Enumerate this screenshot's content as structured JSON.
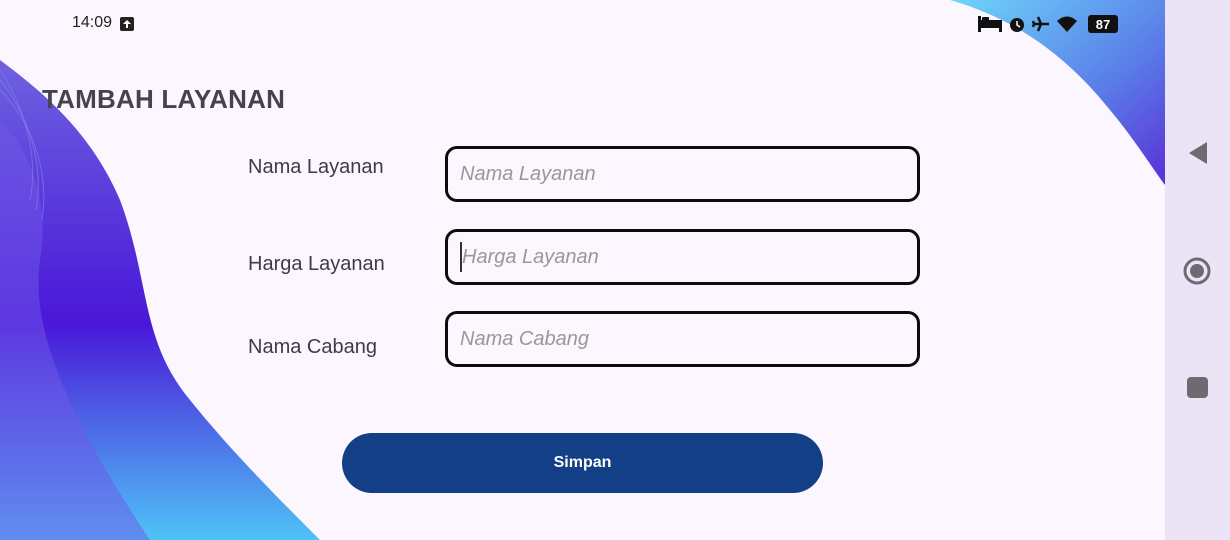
{
  "status_bar": {
    "time": "14:09",
    "battery": "87",
    "icons": [
      "upload-icon",
      "bed-icon",
      "alarm-icon",
      "airplane-icon",
      "wifi-icon",
      "battery-icon"
    ]
  },
  "page": {
    "title": "TAMBAH LAYANAN"
  },
  "form": {
    "fields": [
      {
        "label": "Nama Layanan",
        "placeholder": "Nama Layanan",
        "focused": false
      },
      {
        "label": "Harga Layanan",
        "placeholder": "Harga Layanan",
        "focused": true
      },
      {
        "label": "Nama Cabang",
        "placeholder": "Nama Cabang",
        "focused": false
      }
    ],
    "submit_label": "Simpan"
  },
  "nav_bar": {
    "icons": [
      "back-icon",
      "home-icon",
      "recents-icon"
    ]
  },
  "colors": {
    "button": "#123f86",
    "background": "#fcf6fe",
    "wave": "#5b2fd6"
  }
}
